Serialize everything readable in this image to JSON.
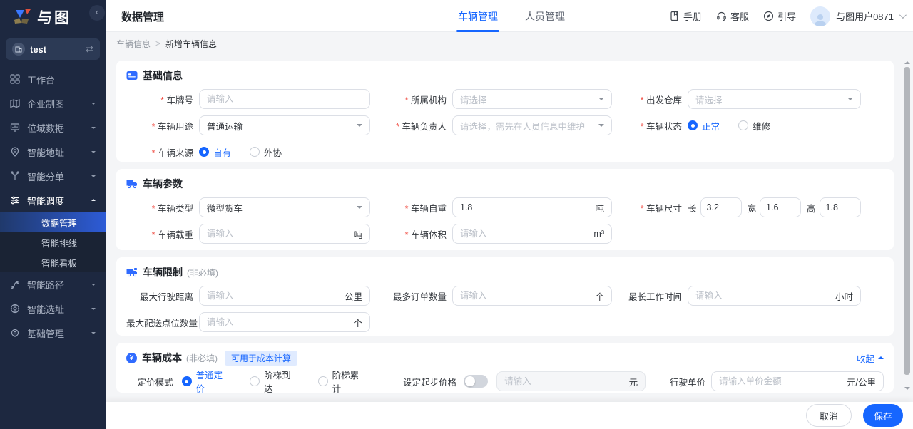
{
  "colors": {
    "accent": "#1666ff",
    "sidebar_bg": "#1d2840",
    "badge_bg": "#e0ebff",
    "required_red": "#f0483e"
  },
  "icons": {
    "switch_workspace": "⇄",
    "sidebar_collapse": "‹",
    "breadcrumb_separator": ">",
    "yen": "¥"
  },
  "brand": {
    "name": "与图"
  },
  "sidebar": {
    "workspace": {
      "name": "test"
    },
    "menu": [
      {
        "label": "工作台"
      },
      {
        "label": "企业制图"
      },
      {
        "label": "位域数据"
      },
      {
        "label": "智能地址"
      },
      {
        "label": "智能分单"
      },
      {
        "label": "智能调度"
      }
    ],
    "submenu": [
      {
        "label": "数据管理"
      },
      {
        "label": "智能排线"
      },
      {
        "label": "智能看板"
      }
    ],
    "menu_bottom": [
      {
        "label": "智能路径"
      },
      {
        "label": "智能选址"
      },
      {
        "label": "基础管理"
      }
    ]
  },
  "header": {
    "page_title": "数据管理",
    "tabs": [
      {
        "label": "车辆管理"
      },
      {
        "label": "人员管理"
      }
    ],
    "actions": [
      {
        "label": "手册"
      },
      {
        "label": "客服"
      },
      {
        "label": "引导"
      }
    ],
    "user_name": "与图用户0871"
  },
  "breadcrumb": {
    "parent": "车辆信息",
    "current": "新增车辆信息"
  },
  "form": {
    "basic": {
      "title": "基础信息",
      "plate_label": "车牌号",
      "plate_placeholder": "请输入",
      "org_label": "所属机构",
      "org_placeholder": "请选择",
      "depot_label": "出发仓库",
      "depot_placeholder": "请选择",
      "usage_label": "车辆用途",
      "usage_value": "普通运输",
      "manager_label": "车辆负责人",
      "manager_placeholder": "请选择，需先在人员信息中维护",
      "status_label": "车辆状态",
      "status_options": [
        "正常",
        "维修"
      ],
      "source_label": "车辆来源",
      "source_options": [
        "自有",
        "外协"
      ]
    },
    "params": {
      "title": "车辆参数",
      "type_label": "车辆类型",
      "type_value": "微型货车",
      "weight_label": "车辆自重",
      "weight_value": "1.8",
      "weight_unit": "吨",
      "size_label": "车辆尺寸",
      "size_len_label": "长",
      "size_len": "3.2",
      "size_w_label": "宽",
      "size_w": "1.6",
      "size_h_label": "高",
      "size_h": "1.8",
      "load_label": "车辆载重",
      "load_placeholder": "请输入",
      "load_unit": "吨",
      "volume_label": "车辆体积",
      "volume_placeholder": "请输入",
      "volume_unit": "m³"
    },
    "limits": {
      "title": "车辆限制",
      "optional": "(非必填)",
      "distance_label": "最大行驶距离",
      "distance_placeholder": "请输入",
      "distance_unit": "公里",
      "orders_label": "最多订单数量",
      "orders_placeholder": "请输入",
      "orders_unit": "个",
      "worktime_label": "最长工作时间",
      "worktime_placeholder": "请输入",
      "worktime_unit": "小时",
      "points_label": "最大配送点位数量",
      "points_placeholder": "请输入",
      "points_unit": "个"
    },
    "cost": {
      "title": "车辆成本",
      "optional": "(非必填)",
      "badge": "可用于成本计算",
      "collapse": "收起",
      "pricing_label": "定价模式",
      "pricing_options": [
        "普通定价",
        "阶梯到达",
        "阶梯累计"
      ],
      "base_toggle_label": "设定起步价格",
      "base_placeholder": "请输入",
      "base_unit": "元",
      "unit_price_label": "行驶单价",
      "unit_price_placeholder": "请输入单价金额",
      "unit_price_unit": "元/公里"
    }
  },
  "footer": {
    "cancel": "取消",
    "save": "保存"
  }
}
